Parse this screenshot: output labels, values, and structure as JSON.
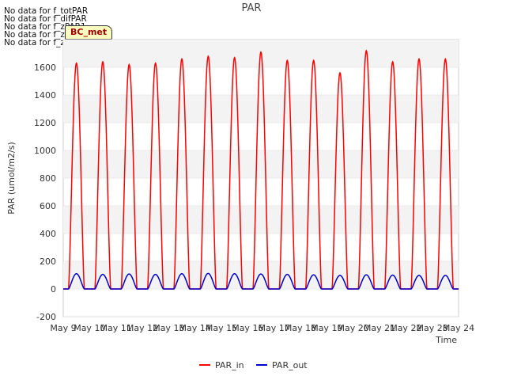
{
  "no_data_messages": [
    "No data for f_totPAR",
    "No data for f_difPAR",
    "No data for f_zPAR1",
    "No data for f_zPAR2",
    "No data for f_zPAR3"
  ],
  "site_badge": "BC_met",
  "colors": {
    "PAR_in": "#ff0000",
    "PAR_out": "#0000cc",
    "band": "#f3f3f3"
  },
  "chart_data": {
    "type": "line",
    "title": "PAR",
    "xlabel": "Time",
    "ylabel": "PAR (umol/m2/s)",
    "ylim": [
      -200,
      1800
    ],
    "yticks": [
      -200,
      0,
      200,
      400,
      600,
      800,
      1000,
      1200,
      1400,
      1600
    ],
    "xlim": [
      "May 9",
      "May 24"
    ],
    "xticks": [
      "May 9",
      "May 10",
      "May 11",
      "May 12",
      "May 13",
      "May 14",
      "May 15",
      "May 16",
      "May 17",
      "May 18",
      "May 19",
      "May 20",
      "May 21",
      "May 22",
      "May 23",
      "May 24"
    ],
    "legend_position": "bottom-center",
    "series": [
      {
        "name": "PAR_in",
        "description_daily_peaks": true,
        "x": [
          "May 9 12:00",
          "May 10 12:00",
          "May 11 12:00",
          "May 12 12:00",
          "May 13 12:00",
          "May 14 12:00",
          "May 15 12:00",
          "May 16 12:00",
          "May 17 12:00",
          "May 18 12:00",
          "May 19 12:00",
          "May 20 12:00",
          "May 21 12:00",
          "May 22 12:00",
          "May 23 12:00"
        ],
        "values": [
          1630,
          1640,
          1620,
          1630,
          1660,
          1680,
          1670,
          1710,
          1650,
          1650,
          1560,
          1720,
          1640,
          1660,
          1660
        ]
      },
      {
        "name": "PAR_out",
        "x": [
          "May 9 12:00",
          "May 10 12:00",
          "May 11 12:00",
          "May 12 12:00",
          "May 13 12:00",
          "May 14 12:00",
          "May 15 12:00",
          "May 16 12:00",
          "May 17 12:00",
          "May 18 12:00",
          "May 19 12:00",
          "May 20 12:00",
          "May 21 12:00",
          "May 22 12:00",
          "May 23 12:00"
        ],
        "values": [
          110,
          105,
          108,
          105,
          110,
          112,
          110,
          108,
          105,
          102,
          98,
          102,
          100,
          98,
          98
        ]
      }
    ]
  }
}
